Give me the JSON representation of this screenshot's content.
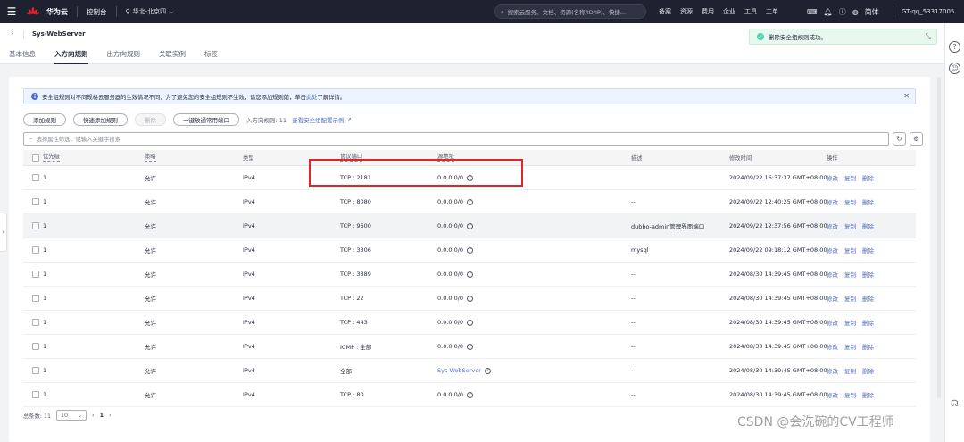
{
  "topbar": {
    "brand": "华为云",
    "logo_sub": "HUAWEI",
    "console": "控制台",
    "region": "华北-北京四",
    "search_placeholder": "搜索云服务、文档、资源(名称/ID/IP)、快捷...",
    "nav": [
      "备案",
      "资源",
      "费用",
      "企业",
      "工具",
      "工单"
    ],
    "lang": "简体",
    "account": "GT-qq_53317005"
  },
  "header": {
    "title": "Sys-WebServer",
    "tabs": [
      "基本信息",
      "入方向规则",
      "出方向规则",
      "关联实例",
      "标签"
    ]
  },
  "toast": {
    "message": "删除安全组规则成功。"
  },
  "notice": {
    "text": "安全组规则对不同规格云服务器的生效情况不同，为了避免您的安全组规则不生效，请您添加规则前，单击",
    "link": "此处",
    "suffix": "了解详情。"
  },
  "toolbar": {
    "add": "添加规则",
    "quick_add": "快速添加规则",
    "delete": "删除",
    "open_ports": "一键放通常用端口",
    "count_label": "入方向规则: 11",
    "example_link": "查看安全组配置示例"
  },
  "filter": {
    "placeholder": "选择属性筛选，或输入关键字搜索"
  },
  "table": {
    "headers": [
      "优先级",
      "策略",
      "类型",
      "协议端口",
      "源地址",
      "描述",
      "修改时间",
      "操作"
    ],
    "ops": [
      "修改",
      "复制",
      "删除"
    ],
    "rows": [
      {
        "pri": "1",
        "policy": "允许",
        "type": "IPv4",
        "port": "TCP : 2181",
        "src": "0.0.0.0/0",
        "desc": "",
        "time": "2024/09/22 16:37:37 GMT+08:00"
      },
      {
        "pri": "1",
        "policy": "允许",
        "type": "IPv4",
        "port": "TCP : 8080",
        "src": "0.0.0.0/0",
        "desc": "--",
        "time": "2024/09/22 12:40:25 GMT+08:00"
      },
      {
        "pri": "1",
        "policy": "允许",
        "type": "IPv4",
        "port": "TCP : 9600",
        "src": "0.0.0.0/0",
        "desc": "dubbo-admin管理界面端口",
        "time": "2024/09/22 12:37:56 GMT+08:00"
      },
      {
        "pri": "1",
        "policy": "允许",
        "type": "IPv4",
        "port": "TCP : 3306",
        "src": "0.0.0.0/0",
        "desc": "mysql",
        "time": "2024/09/22 09:18:12 GMT+08:00"
      },
      {
        "pri": "1",
        "policy": "允许",
        "type": "IPv4",
        "port": "TCP : 3389",
        "src": "0.0.0.0/0",
        "desc": "--",
        "time": "2024/08/30 14:39:45 GMT+08:00"
      },
      {
        "pri": "1",
        "policy": "允许",
        "type": "IPv4",
        "port": "TCP : 22",
        "src": "0.0.0.0/0",
        "desc": "--",
        "time": "2024/08/30 14:39:45 GMT+08:00"
      },
      {
        "pri": "1",
        "policy": "允许",
        "type": "IPv4",
        "port": "TCP : 443",
        "src": "0.0.0.0/0",
        "desc": "--",
        "time": "2024/08/30 14:39:45 GMT+08:00"
      },
      {
        "pri": "1",
        "policy": "允许",
        "type": "IPv4",
        "port": "ICMP : 全部",
        "src": "0.0.0.0/0",
        "desc": "--",
        "time": "2024/08/30 14:39:45 GMT+08:00"
      },
      {
        "pri": "1",
        "policy": "允许",
        "type": "IPv4",
        "port": "全部",
        "src": "Sys-WebServer",
        "desc": "--",
        "time": "2024/08/30 14:39:45 GMT+08:00"
      },
      {
        "pri": "1",
        "policy": "允许",
        "type": "IPv4",
        "port": "TCP : 80",
        "src": "0.0.0.0/0",
        "desc": "--",
        "time": "2024/08/30 14:39:45 GMT+08:00"
      }
    ]
  },
  "pager": {
    "total_label": "总条数: 11",
    "page_size": "10",
    "current": "1"
  },
  "watermark": "CSDN @会洗碗的CV工程师",
  "colors": {
    "topbar": "#1e2230",
    "link": "#526ecc",
    "highlight": "#e0262c",
    "success": "#50d4ab"
  }
}
